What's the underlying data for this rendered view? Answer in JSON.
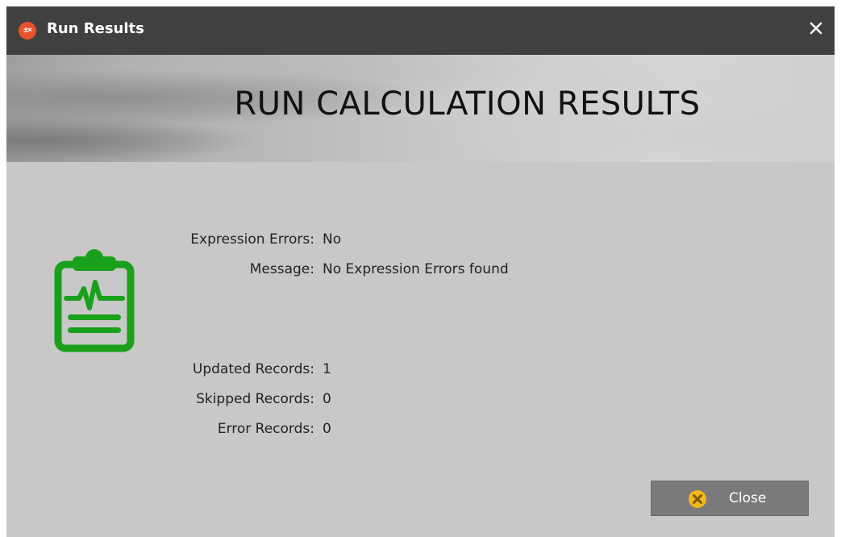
{
  "window": {
    "title": "Run Results",
    "app_icon": "calculator-icon",
    "close_icon": "close-icon"
  },
  "banner": {
    "title": "RUN CALCULATION RESULTS"
  },
  "status_icon": "clipboard-heartbeat-icon",
  "results": {
    "expression_errors_label": "Expression Errors:",
    "expression_errors_value": "No",
    "message_label": "Message:",
    "message_value": "No Expression Errors found",
    "updated_records_label": "Updated Records:",
    "updated_records_value": "1",
    "skipped_records_label": "Skipped Records:",
    "skipped_records_value": "0",
    "error_records_label": "Error Records:",
    "error_records_value": "0"
  },
  "footer": {
    "close_label": "Close",
    "close_icon": "close-circle-icon"
  },
  "colors": {
    "titlebar": "#404040",
    "body_background": "#c8c8c8",
    "status_icon_green": "#1aa01a",
    "close_button": "#7a7a7a",
    "close_icon_yellow": "#f5b81c",
    "app_icon_orange": "#e8532b"
  }
}
